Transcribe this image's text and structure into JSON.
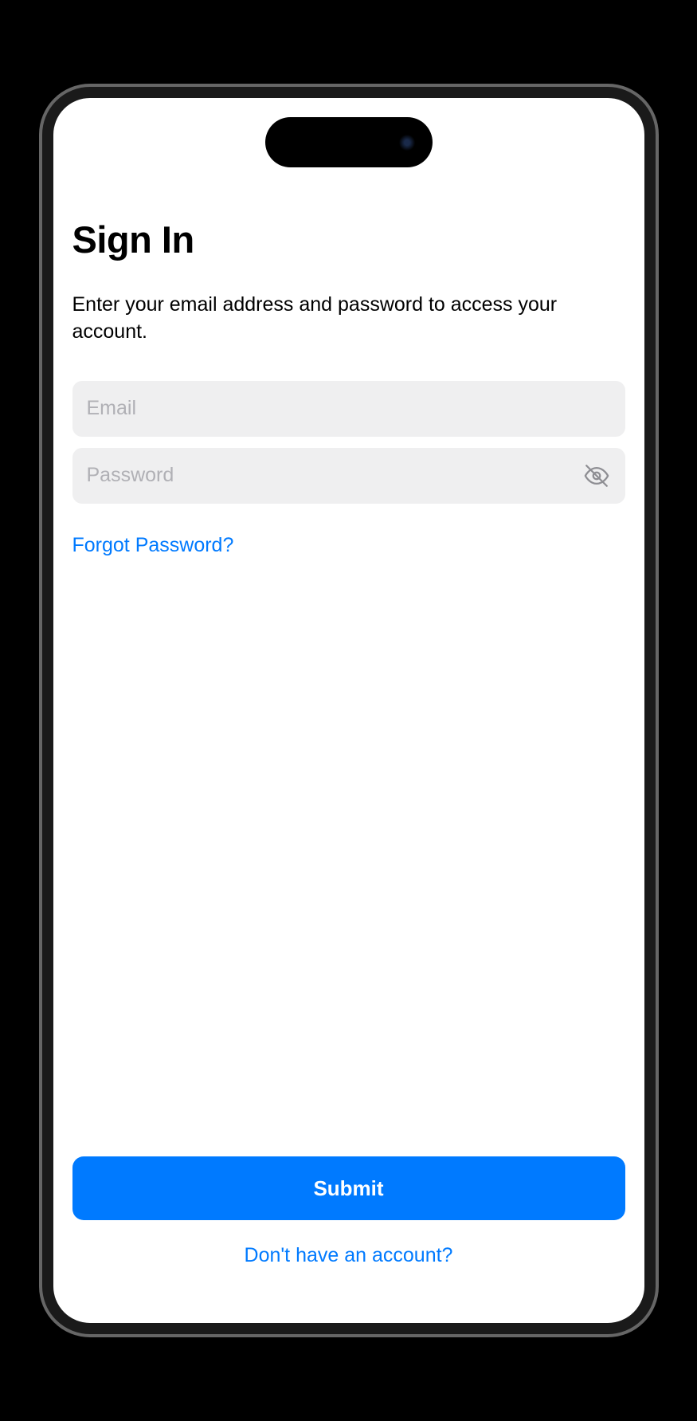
{
  "page": {
    "title": "Sign In",
    "subtitle": "Enter your email address and password to access your account."
  },
  "form": {
    "email": {
      "placeholder": "Email",
      "value": ""
    },
    "password": {
      "placeholder": "Password",
      "value": ""
    }
  },
  "links": {
    "forgot_password": "Forgot Password?",
    "signup": "Don't have an account?"
  },
  "buttons": {
    "submit": "Submit"
  },
  "colors": {
    "accent": "#007aff",
    "input_bg": "#efeff0",
    "placeholder": "#b0b0b5"
  }
}
